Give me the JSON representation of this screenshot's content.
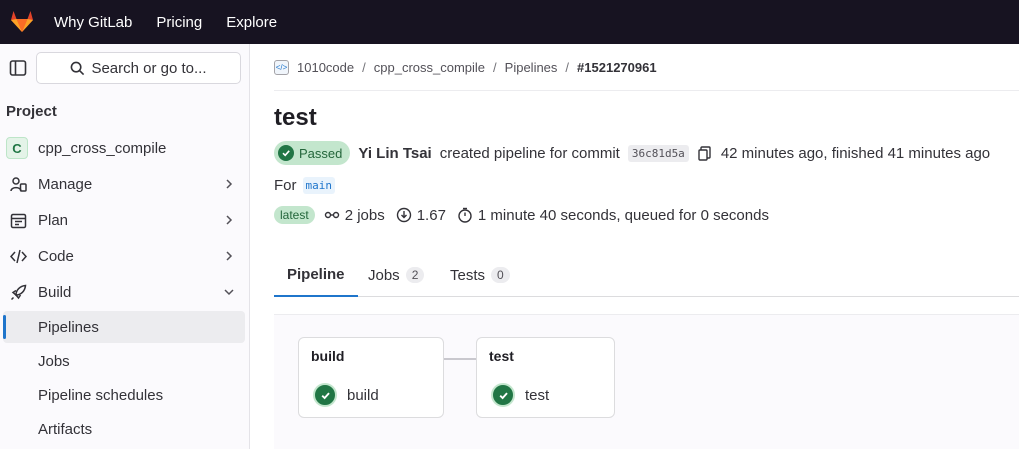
{
  "topbar": {
    "nav": [
      "Why GitLab",
      "Pricing",
      "Explore"
    ]
  },
  "sidebar": {
    "search_label": "Search or go to...",
    "heading": "Project",
    "project": {
      "avatar_letter": "C",
      "name": "cpp_cross_compile"
    },
    "items": [
      {
        "label": "Manage",
        "icon": "users-icon"
      },
      {
        "label": "Plan",
        "icon": "calendar-icon"
      },
      {
        "label": "Code",
        "icon": "code-icon"
      },
      {
        "label": "Build",
        "icon": "rocket-icon"
      }
    ],
    "build_subitems": [
      {
        "label": "Pipelines",
        "active": true
      },
      {
        "label": "Jobs",
        "active": false
      },
      {
        "label": "Pipeline schedules",
        "active": false
      },
      {
        "label": "Artifacts",
        "active": false
      }
    ]
  },
  "breadcrumb": [
    "1010code",
    "cpp_cross_compile",
    "Pipelines",
    "#1521270961"
  ],
  "pipeline": {
    "title": "test",
    "status": "Passed",
    "author": "Yi Lin Tsai",
    "created_text": "created pipeline for commit",
    "commit": "36c81d5a",
    "time_text": "42 minutes ago, finished 41 minutes ago",
    "for_label": "For",
    "branch": "main",
    "latest_badge": "latest",
    "jobs_text": "2 jobs",
    "coverage": "1.67",
    "duration_text": "1 minute 40 seconds, queued for 0 seconds"
  },
  "tabs": [
    {
      "label": "Pipeline",
      "count": null
    },
    {
      "label": "Jobs",
      "count": "2"
    },
    {
      "label": "Tests",
      "count": "0"
    }
  ],
  "stages": [
    {
      "name": "build",
      "jobs": [
        "build"
      ]
    },
    {
      "name": "test",
      "jobs": [
        "test"
      ]
    }
  ],
  "colors": {
    "topbar": "#171321",
    "success": "#217645",
    "accent": "#1f75cb"
  }
}
